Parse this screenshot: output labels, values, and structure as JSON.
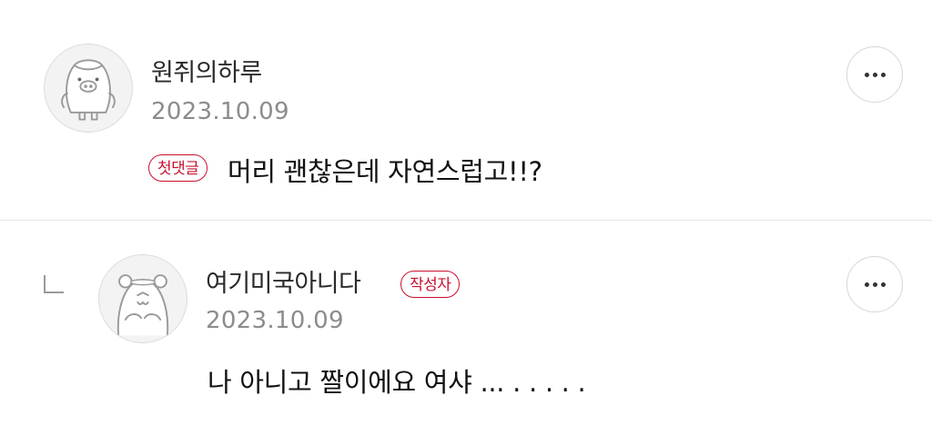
{
  "comments": [
    {
      "username": "원쥐의하루",
      "date": "2023.10.09",
      "badge": "첫댓글",
      "text": "머리 괜찮은데 자연스럽고!!?",
      "more_icon": "more-horizontal-icon",
      "avatar_icon": "penguin-avatar-icon"
    },
    {
      "username": "여기미국아니다",
      "date": "2023.10.09",
      "badge": "작성자",
      "text": "나 아니고 짤이에요 여샤 ... . . . . .",
      "more_icon": "more-horizontal-icon",
      "avatar_icon": "hamster-avatar-icon",
      "is_reply": true
    }
  ],
  "colors": {
    "badge": "#c8102e",
    "date": "#8c8c8c",
    "divider": "#e3e3e3"
  }
}
